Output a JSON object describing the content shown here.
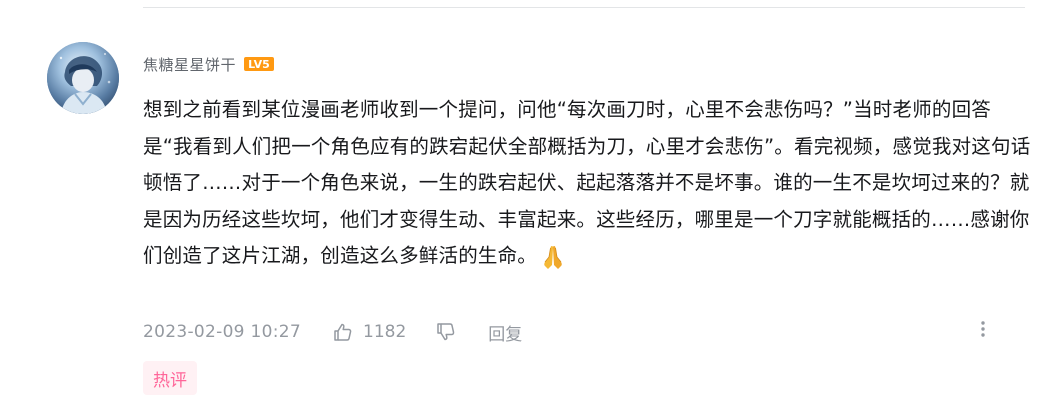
{
  "comment": {
    "username": "焦糖星星饼干",
    "level": "LV5",
    "text": "想到之前看到某位漫画老师收到一个提问，问他“每次画刀时，心里不会悲伤吗？”当时老师的回答是“我看到人们把一个角色应有的跌宕起伏全部概括为刀，心里才会悲伤”。看完视频，感觉我对这句话顿悟了……对于一个角色来说，一生的跌宕起伏、起起落落并不是坏事。谁的一生不是坎坷过来的？就是因为历经这些坎坷，他们才变得生动、丰富起来。这些经历，哪里是一个刀字就能概括的……感谢你们创造了这片江湖，创造这么多鲜活的生命。",
    "emoji": "pray-icon",
    "timestamp": "2023-02-09 10:27",
    "like_count": "1182",
    "reply_label": "回复",
    "hot_tag": "热评"
  },
  "colors": {
    "level_badge": "#ff9912",
    "hot_tag_text": "#ff6699",
    "hot_tag_bg": "#fff1f4",
    "meta_text": "#9499a0",
    "username": "#61666d"
  }
}
